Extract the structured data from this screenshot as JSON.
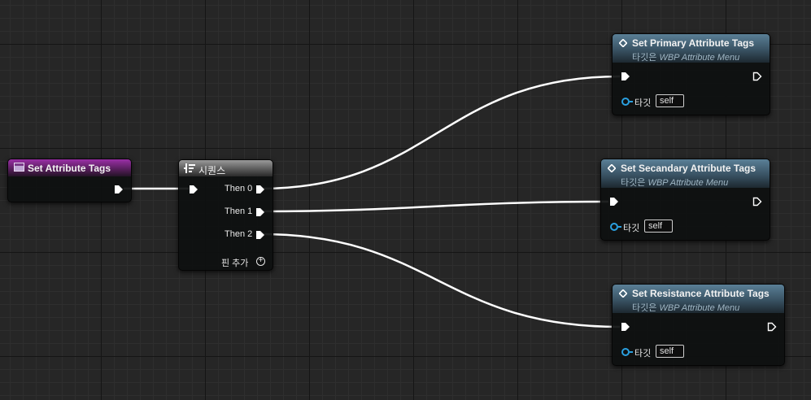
{
  "colors": {
    "exec_wire": "#ffffff",
    "event_header": "#7b2a86",
    "function_header": "#4a6a80",
    "sequence_header": "#6f6f6f",
    "target_pin": "#2aa0e0"
  },
  "nodes": {
    "event": {
      "title": "Set Attribute Tags",
      "icon": "event-icon"
    },
    "sequence": {
      "title": "시퀀스",
      "icon": "sequence-icon",
      "outputs": [
        "Then 0",
        "Then 1",
        "Then 2"
      ],
      "add_pin_label": "핀 추가"
    },
    "primary": {
      "title": "Set Primary Attribute Tags",
      "subtitle_prefix": "타깃은",
      "subtitle_target": "WBP Attribute Menu",
      "target_label": "타깃",
      "target_value": "self"
    },
    "secandary": {
      "title": "Set Secandary Attribute Tags",
      "subtitle_prefix": "타깃은",
      "subtitle_target": "WBP Attribute Menu",
      "target_label": "타깃",
      "target_value": "self"
    },
    "resistance": {
      "title": "Set Resistance Attribute Tags",
      "subtitle_prefix": "타깃은",
      "subtitle_target": "WBP Attribute Menu",
      "target_label": "타깃",
      "target_value": "self"
    }
  }
}
